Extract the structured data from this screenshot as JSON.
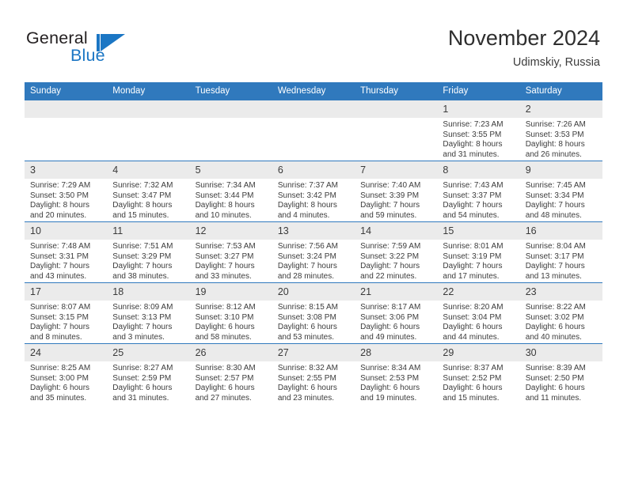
{
  "brand": {
    "name_part1": "General",
    "name_part2": "Blue",
    "logo_icon": "triangle-flag-icon"
  },
  "header": {
    "title": "November 2024",
    "subtitle": "Udimskiy, Russia"
  },
  "calendar": {
    "weekday_headers": [
      "Sunday",
      "Monday",
      "Tuesday",
      "Wednesday",
      "Thursday",
      "Friday",
      "Saturday"
    ],
    "accent_color": "#3079bd",
    "daynum_background": "#ebebeb",
    "weeks": [
      [
        {
          "day": "",
          "lines": []
        },
        {
          "day": "",
          "lines": []
        },
        {
          "day": "",
          "lines": []
        },
        {
          "day": "",
          "lines": []
        },
        {
          "day": "",
          "lines": []
        },
        {
          "day": "1",
          "lines": [
            "Sunrise: 7:23 AM",
            "Sunset: 3:55 PM",
            "Daylight: 8 hours",
            "and 31 minutes."
          ]
        },
        {
          "day": "2",
          "lines": [
            "Sunrise: 7:26 AM",
            "Sunset: 3:53 PM",
            "Daylight: 8 hours",
            "and 26 minutes."
          ]
        }
      ],
      [
        {
          "day": "3",
          "lines": [
            "Sunrise: 7:29 AM",
            "Sunset: 3:50 PM",
            "Daylight: 8 hours",
            "and 20 minutes."
          ]
        },
        {
          "day": "4",
          "lines": [
            "Sunrise: 7:32 AM",
            "Sunset: 3:47 PM",
            "Daylight: 8 hours",
            "and 15 minutes."
          ]
        },
        {
          "day": "5",
          "lines": [
            "Sunrise: 7:34 AM",
            "Sunset: 3:44 PM",
            "Daylight: 8 hours",
            "and 10 minutes."
          ]
        },
        {
          "day": "6",
          "lines": [
            "Sunrise: 7:37 AM",
            "Sunset: 3:42 PM",
            "Daylight: 8 hours",
            "and 4 minutes."
          ]
        },
        {
          "day": "7",
          "lines": [
            "Sunrise: 7:40 AM",
            "Sunset: 3:39 PM",
            "Daylight: 7 hours",
            "and 59 minutes."
          ]
        },
        {
          "day": "8",
          "lines": [
            "Sunrise: 7:43 AM",
            "Sunset: 3:37 PM",
            "Daylight: 7 hours",
            "and 54 minutes."
          ]
        },
        {
          "day": "9",
          "lines": [
            "Sunrise: 7:45 AM",
            "Sunset: 3:34 PM",
            "Daylight: 7 hours",
            "and 48 minutes."
          ]
        }
      ],
      [
        {
          "day": "10",
          "lines": [
            "Sunrise: 7:48 AM",
            "Sunset: 3:31 PM",
            "Daylight: 7 hours",
            "and 43 minutes."
          ]
        },
        {
          "day": "11",
          "lines": [
            "Sunrise: 7:51 AM",
            "Sunset: 3:29 PM",
            "Daylight: 7 hours",
            "and 38 minutes."
          ]
        },
        {
          "day": "12",
          "lines": [
            "Sunrise: 7:53 AM",
            "Sunset: 3:27 PM",
            "Daylight: 7 hours",
            "and 33 minutes."
          ]
        },
        {
          "day": "13",
          "lines": [
            "Sunrise: 7:56 AM",
            "Sunset: 3:24 PM",
            "Daylight: 7 hours",
            "and 28 minutes."
          ]
        },
        {
          "day": "14",
          "lines": [
            "Sunrise: 7:59 AM",
            "Sunset: 3:22 PM",
            "Daylight: 7 hours",
            "and 22 minutes."
          ]
        },
        {
          "day": "15",
          "lines": [
            "Sunrise: 8:01 AM",
            "Sunset: 3:19 PM",
            "Daylight: 7 hours",
            "and 17 minutes."
          ]
        },
        {
          "day": "16",
          "lines": [
            "Sunrise: 8:04 AM",
            "Sunset: 3:17 PM",
            "Daylight: 7 hours",
            "and 13 minutes."
          ]
        }
      ],
      [
        {
          "day": "17",
          "lines": [
            "Sunrise: 8:07 AM",
            "Sunset: 3:15 PM",
            "Daylight: 7 hours",
            "and 8 minutes."
          ]
        },
        {
          "day": "18",
          "lines": [
            "Sunrise: 8:09 AM",
            "Sunset: 3:13 PM",
            "Daylight: 7 hours",
            "and 3 minutes."
          ]
        },
        {
          "day": "19",
          "lines": [
            "Sunrise: 8:12 AM",
            "Sunset: 3:10 PM",
            "Daylight: 6 hours",
            "and 58 minutes."
          ]
        },
        {
          "day": "20",
          "lines": [
            "Sunrise: 8:15 AM",
            "Sunset: 3:08 PM",
            "Daylight: 6 hours",
            "and 53 minutes."
          ]
        },
        {
          "day": "21",
          "lines": [
            "Sunrise: 8:17 AM",
            "Sunset: 3:06 PM",
            "Daylight: 6 hours",
            "and 49 minutes."
          ]
        },
        {
          "day": "22",
          "lines": [
            "Sunrise: 8:20 AM",
            "Sunset: 3:04 PM",
            "Daylight: 6 hours",
            "and 44 minutes."
          ]
        },
        {
          "day": "23",
          "lines": [
            "Sunrise: 8:22 AM",
            "Sunset: 3:02 PM",
            "Daylight: 6 hours",
            "and 40 minutes."
          ]
        }
      ],
      [
        {
          "day": "24",
          "lines": [
            "Sunrise: 8:25 AM",
            "Sunset: 3:00 PM",
            "Daylight: 6 hours",
            "and 35 minutes."
          ]
        },
        {
          "day": "25",
          "lines": [
            "Sunrise: 8:27 AM",
            "Sunset: 2:59 PM",
            "Daylight: 6 hours",
            "and 31 minutes."
          ]
        },
        {
          "day": "26",
          "lines": [
            "Sunrise: 8:30 AM",
            "Sunset: 2:57 PM",
            "Daylight: 6 hours",
            "and 27 minutes."
          ]
        },
        {
          "day": "27",
          "lines": [
            "Sunrise: 8:32 AM",
            "Sunset: 2:55 PM",
            "Daylight: 6 hours",
            "and 23 minutes."
          ]
        },
        {
          "day": "28",
          "lines": [
            "Sunrise: 8:34 AM",
            "Sunset: 2:53 PM",
            "Daylight: 6 hours",
            "and 19 minutes."
          ]
        },
        {
          "day": "29",
          "lines": [
            "Sunrise: 8:37 AM",
            "Sunset: 2:52 PM",
            "Daylight: 6 hours",
            "and 15 minutes."
          ]
        },
        {
          "day": "30",
          "lines": [
            "Sunrise: 8:39 AM",
            "Sunset: 2:50 PM",
            "Daylight: 6 hours",
            "and 11 minutes."
          ]
        }
      ]
    ]
  }
}
